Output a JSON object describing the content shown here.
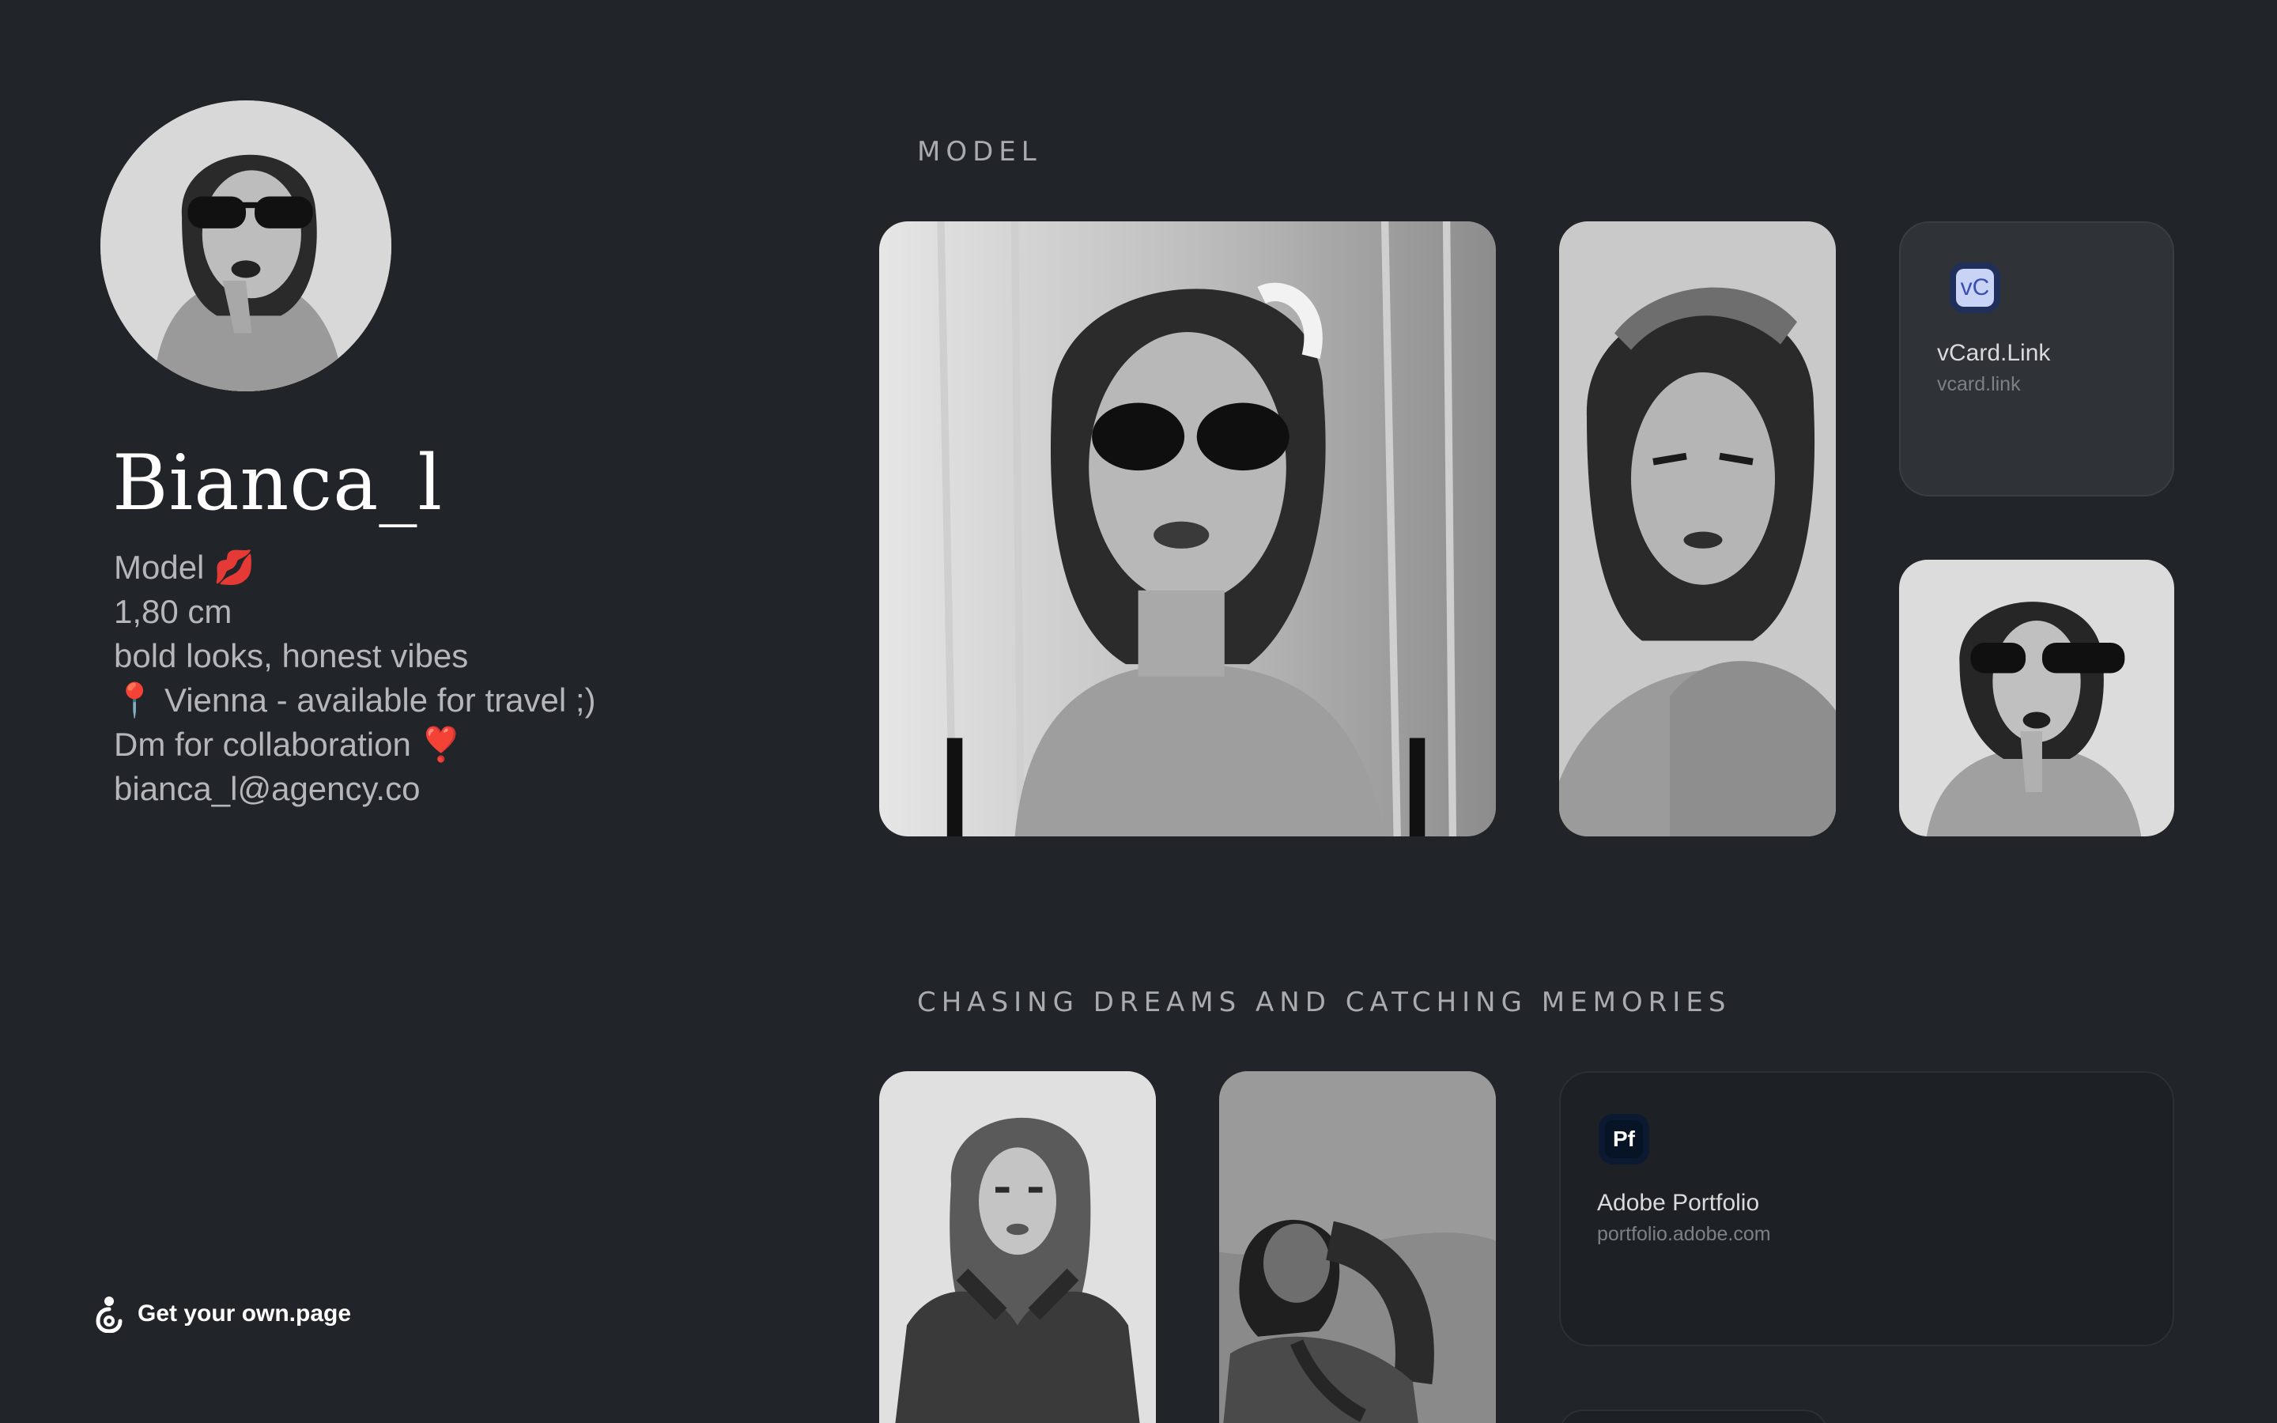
{
  "profile": {
    "name": "Bianca_l",
    "bio_lines": [
      "Model 💋",
      "1,80 cm",
      "bold looks, honest vibes",
      "📍 Vienna - available for travel ;)",
      "Dm for collaboration ❣️",
      "bianca_l@agency.co"
    ]
  },
  "cta": {
    "label": "Get your own.page"
  },
  "sections": [
    {
      "title": "MODEL",
      "link_card": {
        "icon_text": "vC",
        "icon_name": "vcard-link-icon",
        "title": "vCard.Link",
        "subtitle": "vcard.link"
      }
    },
    {
      "title": "CHASING DREAMS AND CATCHING MEMORIES",
      "link_card": {
        "icon_text": "Pf",
        "icon_name": "adobe-portfolio-icon",
        "title": "Adobe Portfolio",
        "subtitle": "portfolio.adobe.com"
      }
    }
  ],
  "colors": {
    "background": "#212428",
    "vcard_icon_bg": "#c9d3f5",
    "vcard_icon_fg": "#3b4fb0",
    "portfolio_icon_bg": "#061426",
    "portfolio_icon_fg": "#ffffff"
  }
}
